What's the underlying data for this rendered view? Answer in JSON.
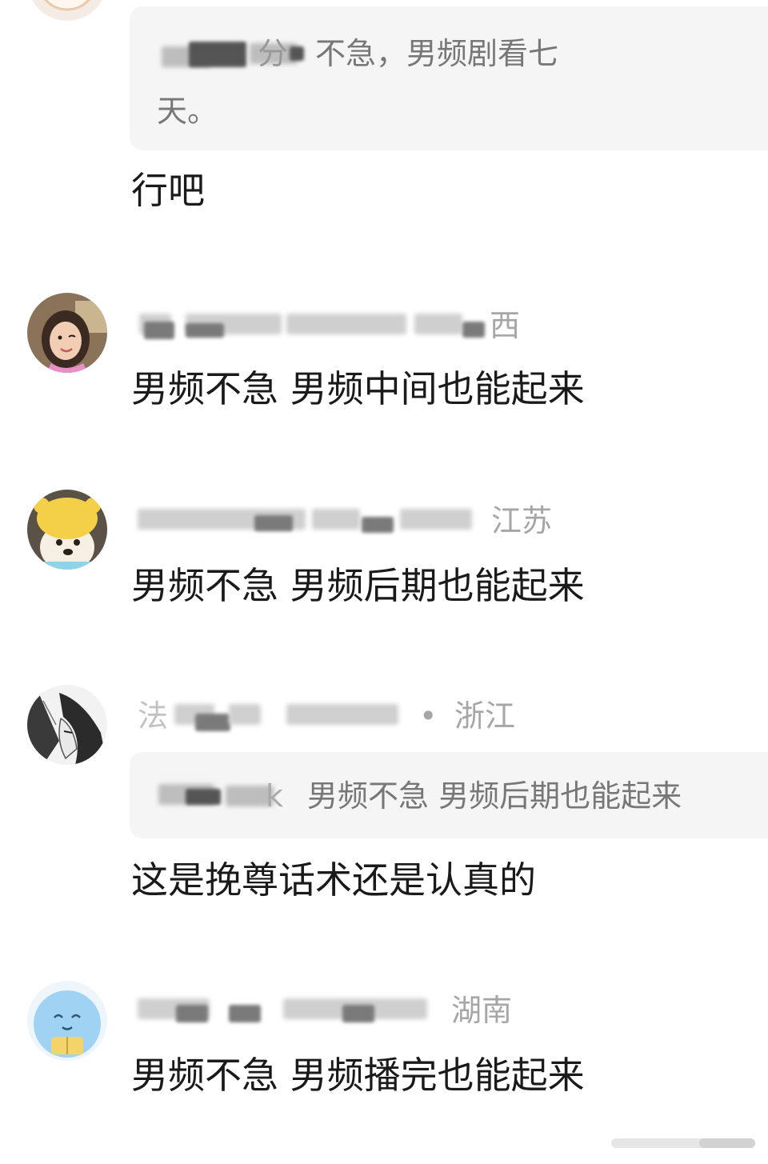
{
  "comments": [
    {
      "quote": {
        "author_fragment": "分",
        "line1": "不急，男频剧看七",
        "line2": "天。"
      },
      "text": "行吧"
    },
    {
      "meta": {
        "location_fragment": "西"
      },
      "text": "男频不急 男频中间也能起来"
    },
    {
      "meta": {
        "location_fragment": "江苏"
      },
      "text": "男频不急 男频后期也能起来"
    },
    {
      "meta": {
        "name_fragment": "法",
        "location": "浙江",
        "separator": "•"
      },
      "quote": {
        "author_fragment": "k",
        "text": "男频不急 男频后期也能起来"
      },
      "text": "这是挽尊话术还是认真的"
    },
    {
      "meta": {
        "location_fragment": "湖南"
      },
      "text": "男频不急 男频播完也能起来"
    }
  ],
  "icons": {
    "avatar_1": "avatar-woman-icon",
    "avatar_2": "avatar-dog-hat-icon",
    "avatar_3": "avatar-anime-icon",
    "avatar_4": "avatar-cartoon-blue-icon"
  },
  "colors": {
    "text_main": "#1a1a1a",
    "text_meta": "#a6a6a6",
    "quote_bg": "#f5f5f5",
    "quote_text": "#777777"
  }
}
